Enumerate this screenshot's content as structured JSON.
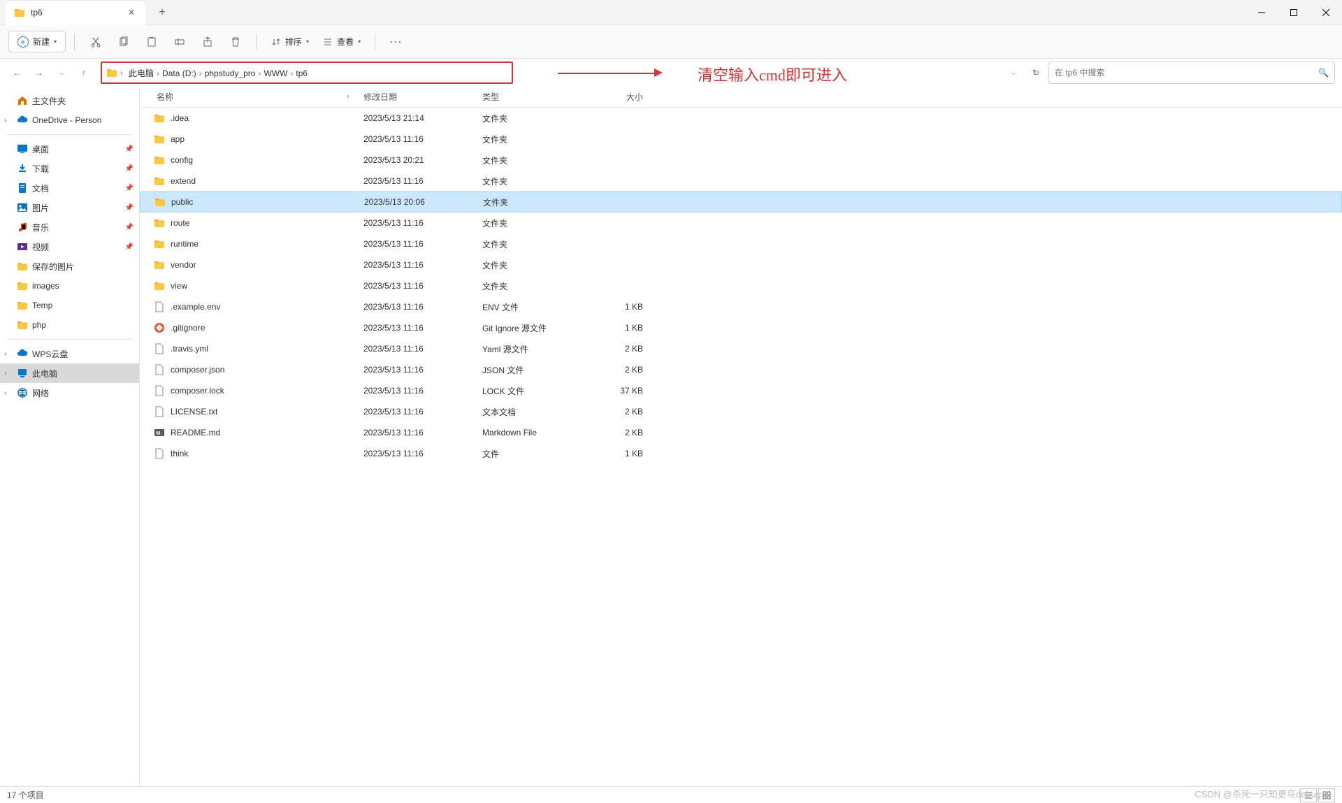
{
  "tab": {
    "title": "tp6"
  },
  "toolbar": {
    "new_label": "新建",
    "sort_label": "排序",
    "view_label": "查看"
  },
  "breadcrumb": [
    "此电脑",
    "Data (D:)",
    "phpstudy_pro",
    "WWW",
    "tp6"
  ],
  "annotation": "清空输入cmd即可进入",
  "search": {
    "placeholder": "在 tp6 中搜索"
  },
  "sidebar": {
    "home": "主文件夹",
    "onedrive": "OneDrive - Person",
    "quick": [
      {
        "label": "桌面",
        "icon": "desktop",
        "color": "#0078d4",
        "pin": true
      },
      {
        "label": "下载",
        "icon": "download",
        "color": "#0078d4",
        "pin": true
      },
      {
        "label": "文档",
        "icon": "document",
        "color": "#0078d4",
        "pin": true
      },
      {
        "label": "图片",
        "icon": "picture",
        "color": "#0078d4",
        "pin": true
      },
      {
        "label": "音乐",
        "icon": "music",
        "color": "#d83b01",
        "pin": true
      },
      {
        "label": "视频",
        "icon": "video",
        "color": "#5b2d90",
        "pin": true
      },
      {
        "label": "保存的图片",
        "icon": "folder",
        "color": "#ffc83d",
        "pin": false
      },
      {
        "label": "images",
        "icon": "folder",
        "color": "#ffc83d",
        "pin": false
      },
      {
        "label": "Temp",
        "icon": "folder",
        "color": "#ffc83d",
        "pin": false
      },
      {
        "label": "php",
        "icon": "folder",
        "color": "#ffc83d",
        "pin": false
      }
    ],
    "bottom": [
      {
        "label": "WPS云盘",
        "icon": "cloud",
        "chev": true
      },
      {
        "label": "此电脑",
        "icon": "pc",
        "chev": true,
        "selected": true
      },
      {
        "label": "网络",
        "icon": "network",
        "chev": true
      }
    ]
  },
  "columns": {
    "name": "名称",
    "date": "修改日期",
    "type": "类型",
    "size": "大小"
  },
  "files": [
    {
      "name": ".idea",
      "date": "2023/5/13 21:14",
      "type": "文件夹",
      "size": "",
      "icon": "folder"
    },
    {
      "name": "app",
      "date": "2023/5/13 11:16",
      "type": "文件夹",
      "size": "",
      "icon": "folder"
    },
    {
      "name": "config",
      "date": "2023/5/13 20:21",
      "type": "文件夹",
      "size": "",
      "icon": "folder"
    },
    {
      "name": "extend",
      "date": "2023/5/13 11:16",
      "type": "文件夹",
      "size": "",
      "icon": "folder"
    },
    {
      "name": "public",
      "date": "2023/5/13 20:06",
      "type": "文件夹",
      "size": "",
      "icon": "folder",
      "selected": true
    },
    {
      "name": "route",
      "date": "2023/5/13 11:16",
      "type": "文件夹",
      "size": "",
      "icon": "folder"
    },
    {
      "name": "runtime",
      "date": "2023/5/13 11:16",
      "type": "文件夹",
      "size": "",
      "icon": "folder"
    },
    {
      "name": "vendor",
      "date": "2023/5/13 11:16",
      "type": "文件夹",
      "size": "",
      "icon": "folder"
    },
    {
      "name": "view",
      "date": "2023/5/13 11:16",
      "type": "文件夹",
      "size": "",
      "icon": "folder"
    },
    {
      "name": ".example.env",
      "date": "2023/5/13 11:16",
      "type": "ENV 文件",
      "size": "1 KB",
      "icon": "file"
    },
    {
      "name": ".gitignore",
      "date": "2023/5/13 11:16",
      "type": "Git Ignore 源文件",
      "size": "1 KB",
      "icon": "git"
    },
    {
      "name": ".travis.yml",
      "date": "2023/5/13 11:16",
      "type": "Yaml 源文件",
      "size": "2 KB",
      "icon": "file"
    },
    {
      "name": "composer.json",
      "date": "2023/5/13 11:16",
      "type": "JSON 文件",
      "size": "2 KB",
      "icon": "file"
    },
    {
      "name": "composer.lock",
      "date": "2023/5/13 11:16",
      "type": "LOCK 文件",
      "size": "37 KB",
      "icon": "file"
    },
    {
      "name": "LICENSE.txt",
      "date": "2023/5/13 11:16",
      "type": "文本文档",
      "size": "2 KB",
      "icon": "file"
    },
    {
      "name": "README.md",
      "date": "2023/5/13 11:16",
      "type": "Markdown File",
      "size": "2 KB",
      "icon": "md"
    },
    {
      "name": "think",
      "date": "2023/5/13 11:16",
      "type": "文件",
      "size": "1 KB",
      "icon": "file"
    }
  ],
  "status": "17 个项目",
  "watermark": "CSDN @杀死一只知更鸟debug"
}
